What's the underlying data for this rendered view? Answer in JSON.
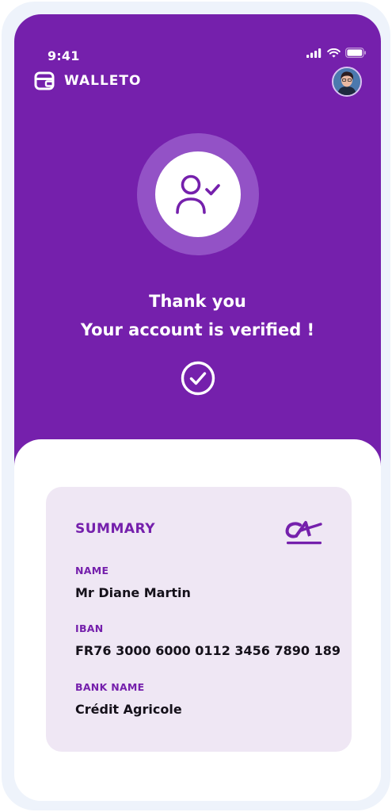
{
  "status_bar": {
    "time": "9:41"
  },
  "header": {
    "app_name": "WALLETO"
  },
  "verification": {
    "line1": "Thank you",
    "line2": "Your account is verified !"
  },
  "summary": {
    "title": "SUMMARY",
    "fields": [
      {
        "label": "NAME",
        "value": "Mr Diane Martin"
      },
      {
        "label": "IBAN",
        "value": "FR76 3000 6000 0112 3456 7890 189"
      },
      {
        "label": "BANK NAME",
        "value": "Crédit Agricole"
      }
    ]
  },
  "colors": {
    "primary": "#7520ac",
    "badge_ring": "#9352c6",
    "card_background": "#efe7f4",
    "frame": "#eef3fb",
    "text_dark": "#15111a"
  },
  "icons": [
    "wallet-icon",
    "signal-icon",
    "wifi-icon",
    "battery-icon",
    "user-check-icon",
    "check-circle-icon",
    "credit-agricole-logo"
  ]
}
